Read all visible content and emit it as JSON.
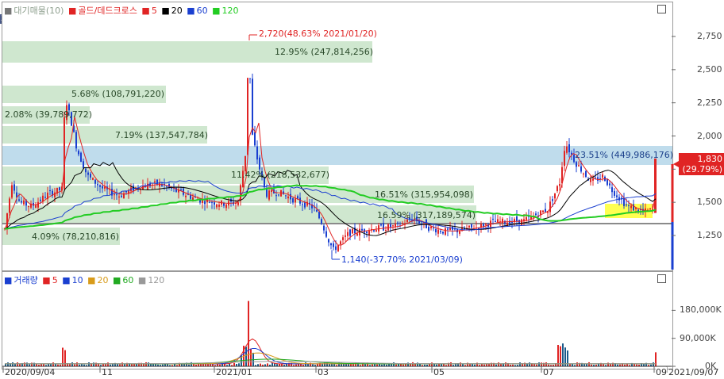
{
  "price_legend": {
    "title": "대기매물(10)",
    "golden_dead": "골드/데드크로스",
    "ma": [
      "5",
      "20",
      "60",
      "120"
    ]
  },
  "volume_legend": {
    "title": "거래량",
    "ma": [
      "5",
      "10",
      "20",
      "60",
      "120"
    ]
  },
  "y_ticks": [
    "2,750",
    "2,500",
    "2,250",
    "2,000",
    "1,750",
    "1,500",
    "1,250"
  ],
  "vol_ticks": [
    "180,000K",
    "90,000K",
    "0K"
  ],
  "x_ticks": [
    "2020/09/04",
    "11",
    "2021/01",
    "03",
    "05",
    "07",
    "09",
    "2021/09/07"
  ],
  "current_price": {
    "value": "1,830",
    "change": "(29.79%)"
  },
  "annotations": {
    "high": "2,720(48.63% 2021/01/20)",
    "low": "1,140(-37.70% 2021/03/09)"
  },
  "supply_bands": [
    {
      "label": "12.95% (247,814,256)"
    },
    {
      "label": "5.68% (108,791,220)"
    },
    {
      "label": "2.08% (39,789,772)"
    },
    {
      "label": "7.19% (137,547,784)"
    },
    {
      "label": "23.51% (449,986,176)"
    },
    {
      "label": "11.42% (218,532,677)"
    },
    {
      "label": "16.51% (315,954,098)"
    },
    {
      "label": "16.59% (317,189,574)"
    },
    {
      "label": "4.09% (78,210,816)"
    }
  ],
  "left_tab": "호",
  "colors": {
    "up": "#e02424",
    "down": "#1a3fd0",
    "ma5": "#e02424",
    "ma20": "#000000",
    "ma60": "#1a3fd0",
    "ma120": "#22cc22",
    "band": "#cfe7cf",
    "band_hi": "#bfdcec",
    "price_box": "#e02424"
  },
  "chart_data": {
    "type": "candlestick",
    "title": "",
    "y_unit": "KRW",
    "ylim": [
      1000,
      2900
    ],
    "x_start": "2020/09/04",
    "x_end": "2021/09/07",
    "high": {
      "value": 2720,
      "pct": 48.63,
      "date": "2021/01/20"
    },
    "low": {
      "value": 1140,
      "pct": -37.7,
      "date": "2021/03/09"
    },
    "current": 1830,
    "volume_ylim": [
      0,
      260000
    ]
  }
}
